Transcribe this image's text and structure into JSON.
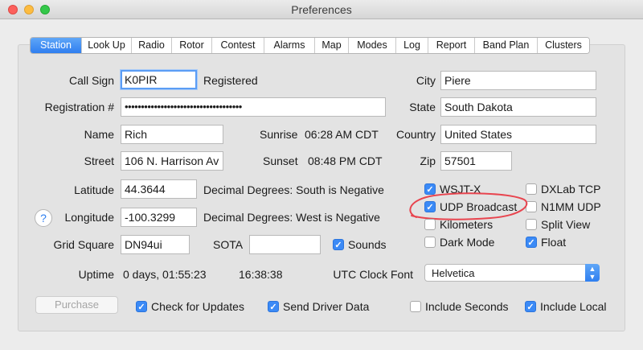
{
  "window": {
    "title": "Preferences"
  },
  "tabs": [
    "Station",
    "Look Up",
    "Radio",
    "Rotor",
    "Contest",
    "Alarms",
    "Map",
    "Modes",
    "Log",
    "Report",
    "Band Plan",
    "Clusters"
  ],
  "labels": {
    "call_sign": "Call Sign",
    "registered": "Registered",
    "registration": "Registration #",
    "name": "Name",
    "street": "Street",
    "latitude": "Latitude",
    "longitude": "Longitude",
    "grid_square": "Grid Square",
    "uptime": "Uptime",
    "sunrise": "Sunrise",
    "sunset": "Sunset",
    "lat_note": "Decimal Degrees: South is Negative",
    "lon_note": "Decimal Degrees: West is Negative",
    "sota": "SOTA",
    "city": "City",
    "state": "State",
    "country": "Country",
    "zip": "Zip",
    "utc_clock_font": "UTC Clock Font"
  },
  "fields": {
    "call_sign": "K0PIR",
    "registration": "••••••••••••••••••••••••••••••••••••",
    "name": "Rich",
    "street": "106 N. Harrison Av",
    "latitude": "44.3644",
    "longitude": "-100.3299",
    "grid_square": "DN94ui",
    "sota": "",
    "city": "Piere",
    "state": "South Dakota",
    "country": "United States",
    "zip": "57501"
  },
  "values": {
    "sunrise": "06:28 AM CDT",
    "sunset": "08:48 PM CDT",
    "uptime": "0 days, 01:55:23",
    "clock": "16:38:38"
  },
  "checkboxes": {
    "sounds": {
      "label": "Sounds",
      "checked": true
    },
    "wsjtx": {
      "label": "WSJT-X",
      "checked": true
    },
    "udp_broadcast": {
      "label": "UDP Broadcast",
      "checked": true
    },
    "kilometers": {
      "label": "Kilometers",
      "checked": false
    },
    "dark_mode": {
      "label": "Dark Mode",
      "checked": false
    },
    "dxlab_tcp": {
      "label": "DXLab TCP",
      "checked": false
    },
    "n1mm_udp": {
      "label": "N1MM UDP",
      "checked": false
    },
    "split_view": {
      "label": "Split View",
      "checked": false
    },
    "float": {
      "label": "Float",
      "checked": true
    },
    "check_updates": {
      "label": "Check for Updates",
      "checked": true
    },
    "send_driver": {
      "label": "Send Driver Data",
      "checked": true
    },
    "include_seconds": {
      "label": "Include Seconds",
      "checked": false
    },
    "include_local": {
      "label": "Include Local",
      "checked": true
    }
  },
  "select": {
    "utc_font": "Helvetica"
  },
  "buttons": {
    "purchase": "Purchase",
    "help": "?"
  },
  "colors": {
    "accent": "#2f7ff0",
    "annotation": "#e8454f"
  }
}
